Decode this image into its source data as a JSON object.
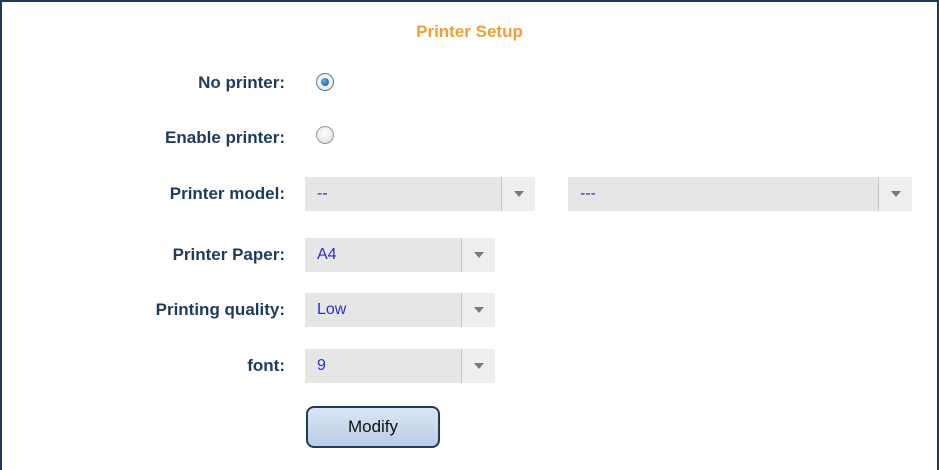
{
  "section": {
    "title": "Printer Setup"
  },
  "printer_mode": {
    "no_printer_label": "No printer:",
    "enable_printer_label": "Enable printer:",
    "selected": "No printer"
  },
  "printer_model": {
    "label": "Printer model:",
    "primary_value": "--",
    "secondary_value": "---"
  },
  "printer_paper": {
    "label": "Printer Paper:",
    "value": "A4"
  },
  "printing_quality": {
    "label": "Printing quality:",
    "value": "Low"
  },
  "font": {
    "label": "font:",
    "value": "9"
  },
  "actions": {
    "modify_label": "Modify"
  },
  "colors": {
    "title": "#f0a030",
    "label": "#1d3c5c",
    "select_text": "#2233cc",
    "border": "#1d3c5c"
  }
}
